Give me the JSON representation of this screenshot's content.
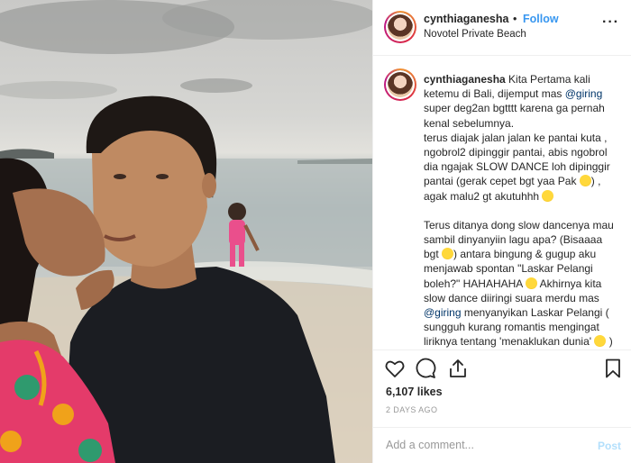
{
  "post": {
    "username": "cynthiaganesha",
    "separator": "•",
    "follow_label": "Follow",
    "location": "Novotel Private Beach",
    "more_label": "···"
  },
  "caption": {
    "username": "cynthiaganesha",
    "p1_a": "Kita Pertama kali ketemu di Bali, dijemput mas ",
    "p1_mention": "@giring",
    "p1_b": " super deg2an bgtttt karena ga pernah kenal sebelumnya.",
    "p2_a": "terus diajak jalan jalan ke pantai kuta , ngobrol2 dipinggir pantai, abis ngobrol dia ngajak SLOW DANCE loh dipinggir pantai (gerak cepet bgt yaa Pak ",
    "p2_b": ") , agak malu2 gt akutuhhh ",
    "p3_a": "Terus ditanya dong slow dancenya mau sambil dinyanyiin lagu apa? (Bisaaaa bgt ",
    "p3_b": ") antara bingung & gugup aku menjawab spontan \"Laskar Pelangi boleh?\" HAHAHAHA ",
    "p3_c": " Akhirnya kita slow dance diiringi suara merdu mas ",
    "p3_mention": "@giring",
    "p3_d": " menyanyikan Laskar Pelangi ( sungguh kurang romantis mengingat liriknya tentang 'menaklukan dunia' ",
    "p3_e": " )"
  },
  "actions": {
    "like_icon": "heart-icon",
    "comment_icon": "comment-icon",
    "share_icon": "share-icon",
    "save_icon": "bookmark-icon"
  },
  "likes_text": "6,107 likes",
  "time_ago": "2 DAYS AGO",
  "comment": {
    "placeholder": "Add a comment...",
    "post_label": "Post"
  },
  "colors": {
    "link": "#3897f0",
    "mention": "#003569",
    "post_disabled": "#b2dffc",
    "shirt": "#1b1d22",
    "dress": "#e43b6a"
  }
}
